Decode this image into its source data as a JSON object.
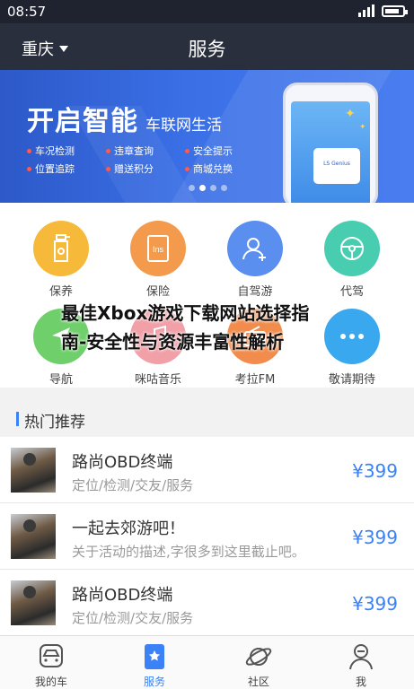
{
  "status": {
    "time": "08:57",
    "battery_level": 0.85
  },
  "header": {
    "city": "重庆",
    "title": "服务"
  },
  "banner": {
    "title": "开启智能",
    "subtitle": "车联网生活",
    "features": [
      "车况检测",
      "违章查询",
      "安全提示",
      "位置追踪",
      "赠送积分",
      "商城兑换"
    ],
    "device_label": "LS Genius",
    "active_slide": 1,
    "slide_count": 4
  },
  "services": [
    {
      "label": "保养",
      "icon": "bottle-icon",
      "color": "#f7b93a"
    },
    {
      "label": "保险",
      "icon": "insurance-icon",
      "color": "#f39a4d"
    },
    {
      "label": "自驾游",
      "icon": "person-add-icon",
      "color": "#5a8ff0"
    },
    {
      "label": "代驾",
      "icon": "steering-wheel-icon",
      "color": "#48cdb0"
    },
    {
      "label": "导航",
      "icon": "navigation-icon",
      "color": "#6fcf6b"
    },
    {
      "label": "咪咕音乐",
      "icon": "music-icon",
      "color": "#f1a0a8"
    },
    {
      "label": "考拉FM",
      "icon": "radio-icon",
      "color": "#f28c4c"
    },
    {
      "label": "敬请期待",
      "icon": "more-icon",
      "color": "#3aa8ee"
    }
  ],
  "overlay_text": [
    "最佳Xbox游戏下载网站选择指",
    "南-安全性与资源丰富性解析"
  ],
  "hot": {
    "title": "热门推荐",
    "items": [
      {
        "title": "路尚OBD终端",
        "desc": "定位/检测/交友/服务",
        "price": "¥399"
      },
      {
        "title": "一起去郊游吧！",
        "desc": "关于活动的描述,字很多到这里截止吧。",
        "price": "¥399"
      },
      {
        "title": "路尚OBD终端",
        "desc": "定位/检测/交友/服务",
        "price": "¥399"
      }
    ]
  },
  "tabbar": [
    {
      "label": "我的车",
      "icon": "car-icon"
    },
    {
      "label": "服务",
      "icon": "service-icon",
      "active": true
    },
    {
      "label": "社区",
      "icon": "planet-icon"
    },
    {
      "label": "我",
      "icon": "profile-icon"
    }
  ],
  "colors": {
    "accent": "#3b82f6",
    "nav_bg": "#2a2f3d",
    "status_bg": "#1f2330"
  }
}
